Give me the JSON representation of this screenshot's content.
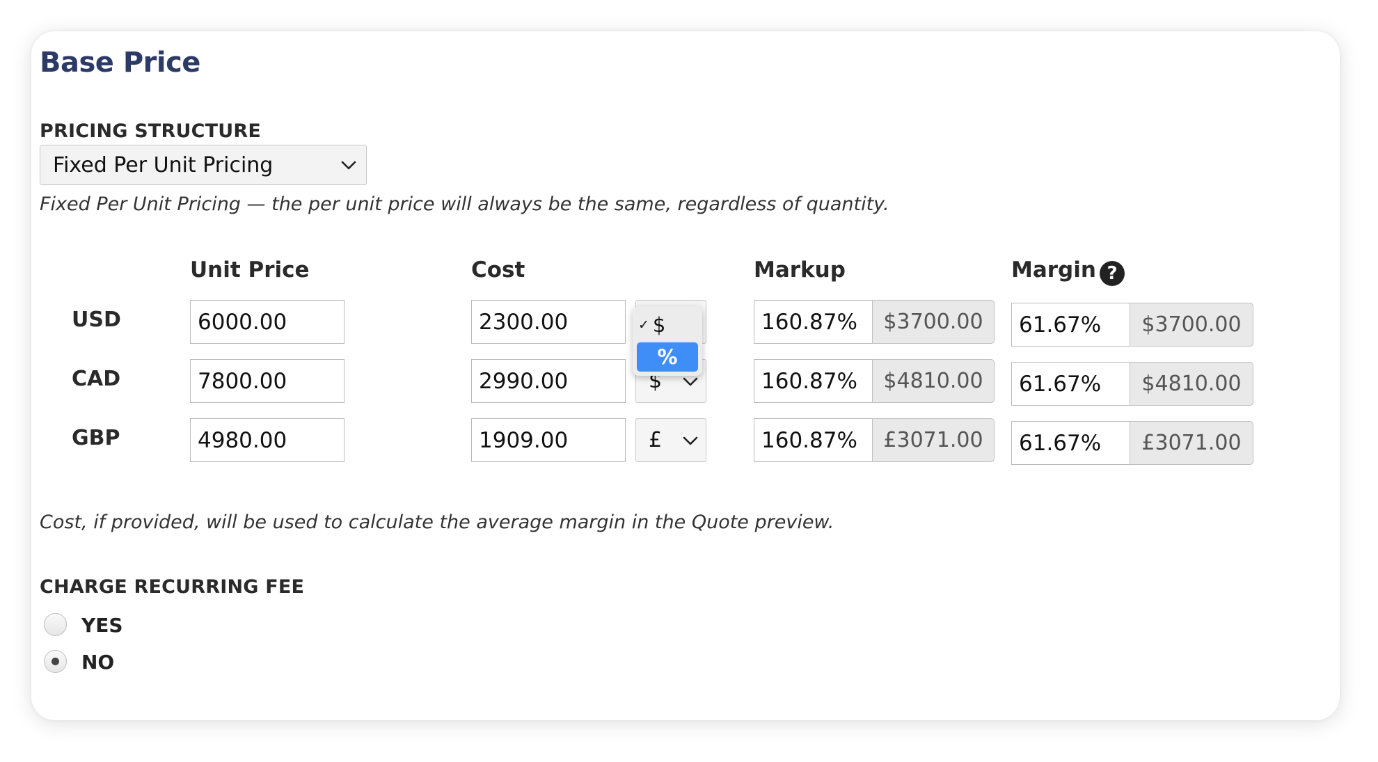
{
  "title": "Base Price",
  "pricing_structure": {
    "label": "PRICING STRUCTURE",
    "selected": "Fixed Per Unit Pricing",
    "description": "Fixed Per Unit Pricing — the per unit price will always be the same, regardless of quantity."
  },
  "columns": {
    "unit_price": "Unit Price",
    "cost": "Cost",
    "markup": "Markup",
    "margin": "Margin"
  },
  "rows": [
    {
      "currency": "USD",
      "unit_price": "6000.00",
      "cost": "2300.00",
      "cost_unit": "$",
      "markup_pct": "160.87%",
      "markup_amt": "$3700.00",
      "margin_pct": "61.67%",
      "margin_amt": "$3700.00"
    },
    {
      "currency": "CAD",
      "unit_price": "7800.00",
      "cost": "2990.00",
      "cost_unit": "$",
      "markup_pct": "160.87%",
      "markup_amt": "$4810.00",
      "margin_pct": "61.67%",
      "margin_amt": "$4810.00"
    },
    {
      "currency": "GBP",
      "unit_price": "4980.00",
      "cost": "1909.00",
      "cost_unit": "£",
      "markup_pct": "160.87%",
      "markup_amt": "£3071.00",
      "margin_pct": "61.67%",
      "margin_amt": "£3071.00"
    }
  ],
  "cost_unit_dropdown": {
    "options": [
      "$",
      "%"
    ],
    "checked": "$",
    "highlighted": "%"
  },
  "cost_note": "Cost, if provided, will be used to calculate the average margin in the Quote preview.",
  "recurring_fee": {
    "label": "CHARGE RECURRING FEE",
    "options": [
      "YES",
      "NO"
    ],
    "selected": "NO"
  },
  "icons": {
    "chevron": "chevron-down-icon",
    "help": "help-icon",
    "check": "checkmark-icon"
  },
  "colors": {
    "title": "#2c3a66",
    "highlight": "#3f8ef7"
  }
}
